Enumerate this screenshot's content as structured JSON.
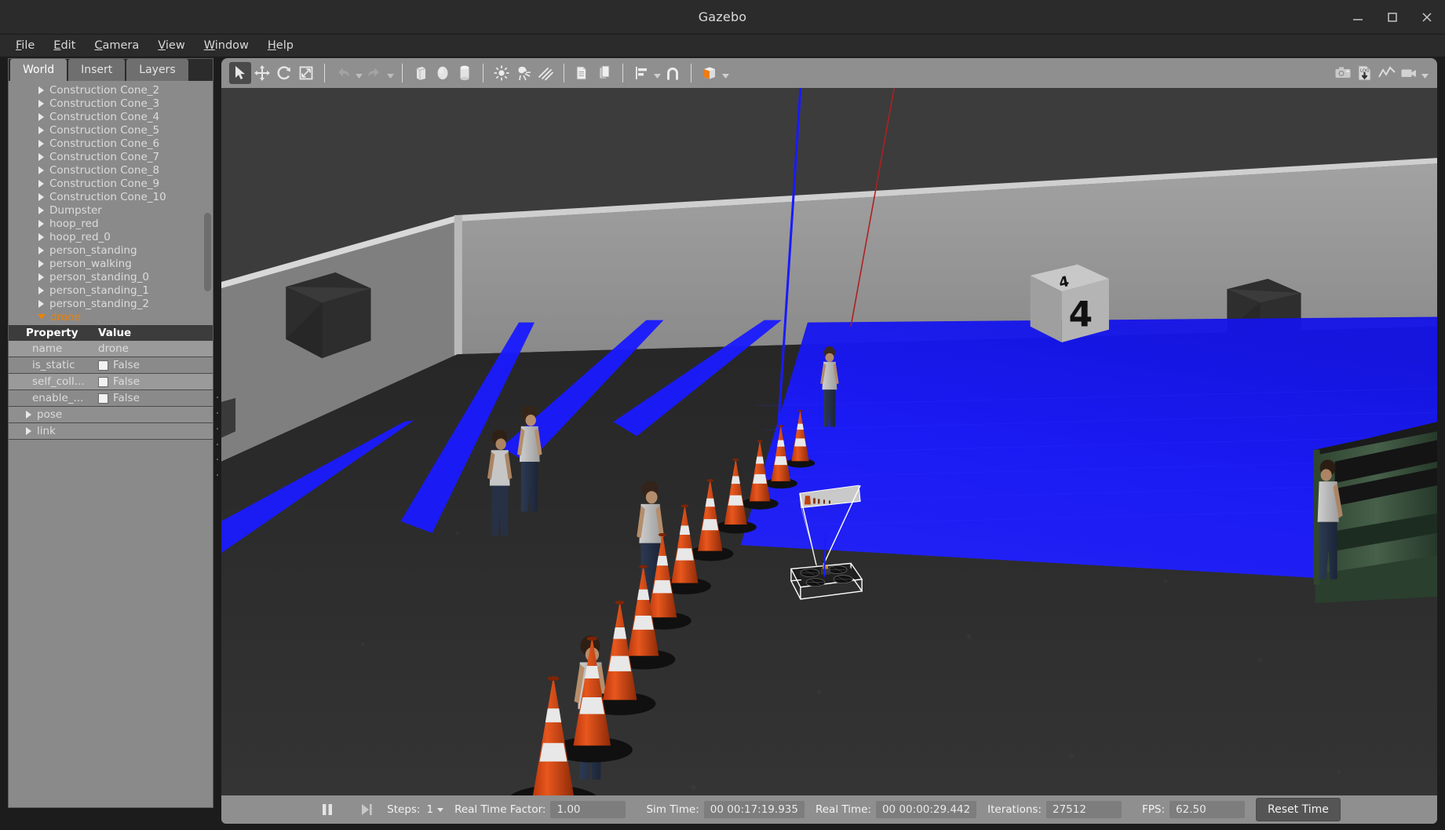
{
  "window": {
    "title": "Gazebo",
    "controls": [
      {
        "name": "minimize",
        "glyph": "minimize-icon"
      },
      {
        "name": "maximize",
        "glyph": "maximize-icon"
      },
      {
        "name": "close",
        "glyph": "close-icon"
      }
    ]
  },
  "menubar": {
    "items": [
      {
        "label": "File",
        "mnemonic": "F"
      },
      {
        "label": "Edit",
        "mnemonic": "E"
      },
      {
        "label": "Camera",
        "mnemonic": "C"
      },
      {
        "label": "View",
        "mnemonic": "V"
      },
      {
        "label": "Window",
        "mnemonic": "W"
      },
      {
        "label": "Help",
        "mnemonic": "H"
      }
    ]
  },
  "left_panel": {
    "tabs": [
      {
        "label": "World",
        "active": true
      },
      {
        "label": "Insert",
        "active": false
      },
      {
        "label": "Layers",
        "active": false
      }
    ],
    "tree_items": [
      {
        "label": "Construction Cone_2",
        "expanded": false,
        "selected": false
      },
      {
        "label": "Construction Cone_3",
        "expanded": false,
        "selected": false
      },
      {
        "label": "Construction Cone_4",
        "expanded": false,
        "selected": false
      },
      {
        "label": "Construction Cone_5",
        "expanded": false,
        "selected": false
      },
      {
        "label": "Construction Cone_6",
        "expanded": false,
        "selected": false
      },
      {
        "label": "Construction Cone_7",
        "expanded": false,
        "selected": false
      },
      {
        "label": "Construction Cone_8",
        "expanded": false,
        "selected": false
      },
      {
        "label": "Construction Cone_9",
        "expanded": false,
        "selected": false
      },
      {
        "label": "Construction Cone_10",
        "expanded": false,
        "selected": false
      },
      {
        "label": "Dumpster",
        "expanded": false,
        "selected": false
      },
      {
        "label": "hoop_red",
        "expanded": false,
        "selected": false
      },
      {
        "label": "hoop_red_0",
        "expanded": false,
        "selected": false
      },
      {
        "label": "person_standing",
        "expanded": false,
        "selected": false
      },
      {
        "label": "person_walking",
        "expanded": false,
        "selected": false
      },
      {
        "label": "person_standing_0",
        "expanded": false,
        "selected": false
      },
      {
        "label": "person_standing_1",
        "expanded": false,
        "selected": false
      },
      {
        "label": "person_standing_2",
        "expanded": false,
        "selected": false
      },
      {
        "label": "drone",
        "expanded": true,
        "selected": true
      }
    ],
    "property_table": {
      "headers": [
        "Property",
        "Value"
      ],
      "rows": [
        {
          "property": "name",
          "value": "drone",
          "type": "text"
        },
        {
          "property": "is_static",
          "value": "False",
          "type": "checkbox",
          "checked": false
        },
        {
          "property": "self_coll...",
          "value": "False",
          "type": "checkbox",
          "checked": false
        },
        {
          "property": "enable_...",
          "value": "False",
          "type": "checkbox",
          "checked": false
        },
        {
          "property": "pose",
          "value": "",
          "type": "group"
        },
        {
          "property": "link",
          "value": "",
          "type": "group"
        }
      ]
    }
  },
  "toolbar": {
    "left_tools": [
      {
        "name": "select-mode",
        "icon": "cursor-arrow-icon",
        "active": true,
        "disabled": false
      },
      {
        "name": "translate-mode",
        "icon": "move-arrows-icon",
        "active": false,
        "disabled": false
      },
      {
        "name": "rotate-mode",
        "icon": "rotate-icon",
        "active": false,
        "disabled": false
      },
      {
        "name": "scale-mode",
        "icon": "scale-icon",
        "active": false,
        "disabled": false
      },
      {
        "name": "undo",
        "icon": "undo-arrow-icon",
        "active": false,
        "disabled": true
      },
      {
        "name": "redo",
        "icon": "redo-arrow-icon",
        "active": false,
        "disabled": true
      },
      {
        "name": "insert-box",
        "icon": "box-icon",
        "active": false,
        "disabled": false
      },
      {
        "name": "insert-sphere",
        "icon": "sphere-icon",
        "active": false,
        "disabled": false
      },
      {
        "name": "insert-cylinder",
        "icon": "cylinder-icon",
        "active": false,
        "disabled": false
      },
      {
        "name": "insert-point-light",
        "icon": "point-light-icon",
        "active": false,
        "disabled": false
      },
      {
        "name": "insert-spot-light",
        "icon": "spot-light-icon",
        "active": false,
        "disabled": false
      },
      {
        "name": "insert-directional-light",
        "icon": "directional-light-icon",
        "active": false,
        "disabled": false
      },
      {
        "name": "copy",
        "icon": "copy-icon",
        "active": false,
        "disabled": false
      },
      {
        "name": "paste",
        "icon": "paste-icon",
        "active": false,
        "disabled": false
      },
      {
        "name": "align",
        "icon": "align-icon",
        "active": false,
        "disabled": false
      },
      {
        "name": "snap",
        "icon": "magnet-icon",
        "active": false,
        "disabled": false
      },
      {
        "name": "view-angle",
        "icon": "view-cube-icon",
        "active": false,
        "disabled": false
      }
    ],
    "right_tools": [
      {
        "name": "screenshot",
        "icon": "camera-icon"
      },
      {
        "name": "save-log",
        "icon": "log-download-icon"
      },
      {
        "name": "plot",
        "icon": "plot-line-icon"
      },
      {
        "name": "record-video",
        "icon": "video-camera-icon"
      }
    ]
  },
  "statusbar": {
    "play_pause_icon": "pause-icon",
    "step_icon": "step-forward-icon",
    "steps_label": "Steps:",
    "steps_value": "1",
    "real_time_factor_label": "Real Time Factor:",
    "real_time_factor_value": "1.00",
    "sim_time_label": "Sim Time:",
    "sim_time_value": "00 00:17:19.935",
    "real_time_label": "Real Time:",
    "real_time_value": "00 00:00:29.442",
    "iterations_label": "Iterations:",
    "iterations_value": "27512",
    "fps_label": "FPS:",
    "fps_value": "62.50",
    "reset_button": "Reset Time"
  },
  "scene": {
    "name": "gazebo-3d-viewport",
    "background_color": "#3c3c3c",
    "wall_color": "#8e8e8e",
    "ground_color": "#2a2a2a",
    "laser_color": "#1414ff",
    "selection_color": "#ffffff",
    "cube_marker_label": "4",
    "objects": [
      {
        "name": "drone",
        "type": "quadcopter",
        "selected": true
      },
      {
        "name": "camera-frustum",
        "type": "frustum"
      },
      {
        "name": "numbered-cube",
        "type": "box",
        "label": "4"
      },
      {
        "name": "dumpster",
        "type": "dumpster"
      },
      {
        "name": "traffic-cones",
        "type": "cone-row",
        "count": 12
      },
      {
        "name": "people",
        "type": "person-group",
        "count": 7
      },
      {
        "name": "dark-boxes",
        "type": "box-group",
        "count": 3
      }
    ]
  }
}
